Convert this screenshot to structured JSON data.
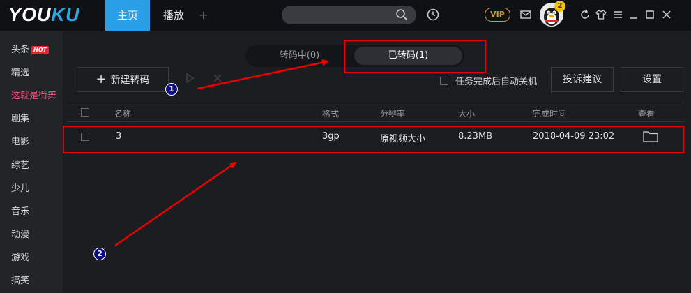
{
  "app": {
    "logo_part1": "YOU",
    "logo_part2": "KU",
    "tabs": [
      {
        "label": "主页",
        "active": true
      },
      {
        "label": "播放",
        "active": false
      }
    ],
    "add_tab": "+",
    "vip": "VIP",
    "badge": "2"
  },
  "sidebar": {
    "items": [
      {
        "label": "头条",
        "hot": "HOT"
      },
      {
        "label": "精选"
      },
      {
        "label": "这就是街舞",
        "active": true
      },
      {
        "label": "剧集"
      },
      {
        "label": "电影"
      },
      {
        "label": "综艺"
      },
      {
        "label": "少儿"
      },
      {
        "label": "音乐"
      },
      {
        "label": "动漫"
      },
      {
        "label": "游戏"
      },
      {
        "label": "搞笑"
      }
    ]
  },
  "segment": {
    "converting": "转码中(0)",
    "converted": "已转码(1)",
    "active": "converted"
  },
  "toolbar": {
    "new_convert": "新建转码",
    "plus": "+",
    "auto_shutdown": "任务完成后自动关机",
    "feedback": "投诉建议",
    "settings": "设置"
  },
  "table": {
    "headers": {
      "name": "名称",
      "format": "格式",
      "resolution": "分辨率",
      "size": "大小",
      "finish_time": "完成时间",
      "view": "查看"
    },
    "rows": [
      {
        "name": "3",
        "format": "3gp",
        "resolution": "原视频大小",
        "size": "8.23MB",
        "finish_time": "2018-04-09 23:02"
      }
    ]
  },
  "annotations": {
    "marker1": "1",
    "marker2": "2",
    "color": "#ee0000"
  },
  "colors": {
    "accent": "#2a9ee6",
    "sidebar_active": "#e8547a",
    "vip_gold": "#c99a3b"
  }
}
